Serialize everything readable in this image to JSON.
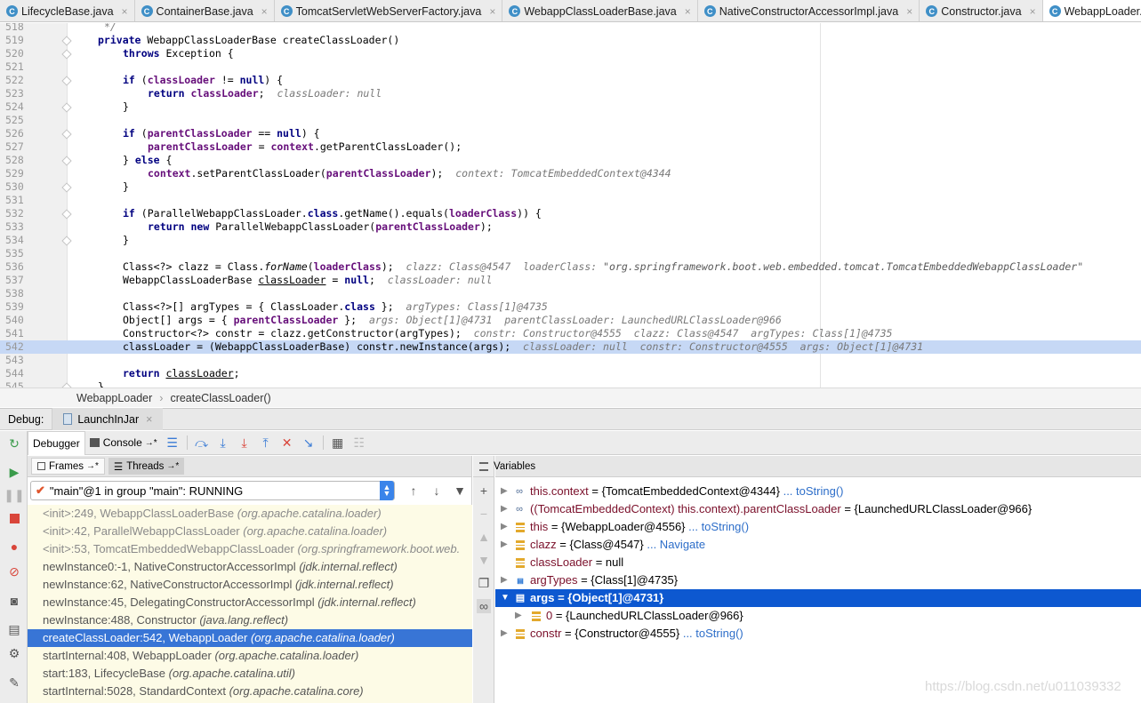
{
  "tabs": [
    {
      "label": "LifecycleBase.java"
    },
    {
      "label": "ContainerBase.java"
    },
    {
      "label": "TomcatServletWebServerFactory.java"
    },
    {
      "label": "WebappClassLoaderBase.java"
    },
    {
      "label": "NativeConstructorAccessorImpl.java"
    },
    {
      "label": "Constructor.java"
    },
    {
      "label": "WebappLoader.java"
    }
  ],
  "tab_icon_letter": "C",
  "tab_close": "×",
  "editor": {
    "line_numbers": [
      "518",
      "519",
      "520",
      "521",
      "522",
      "523",
      "524",
      "525",
      "526",
      "527",
      "528",
      "529",
      "530",
      "531",
      "532",
      "533",
      "534",
      "535",
      "536",
      "537",
      "538",
      "539",
      "540",
      "541",
      "542",
      "543",
      "544",
      "545"
    ],
    "current_line": "542",
    "comment_518": "*/",
    "l519_private": "private",
    "l519_rest": "WebappClassLoaderBase createClassLoader()",
    "l520_throws": "throws",
    "l520_rest": "Exception {",
    "kw_if": "if",
    "kw_null": "null",
    "kw_return": "return",
    "kw_else": "else",
    "kw_class": "class",
    "kw_new": "new",
    "f_classLoader": "classLoader",
    "f_parentClassLoader": "parentClassLoader",
    "f_context": "context",
    "f_loaderClass": "loaderClass",
    "brace_close": "}",
    "l522_mid": " != ",
    "l522_end": ") {",
    "l523_end": ";",
    "hint_523": "classLoader: null",
    "l526_mid": " == ",
    "l527_mid": " = ",
    "l527_call": ".getParentClassLoader();",
    "l528_a": "} ",
    "l528_b": " {",
    "l529_call": ".setParentClassLoader(",
    "l529_end": ");",
    "hint_529": "context: TomcatEmbeddedContext@4344",
    "l532_a": " (ParallelWebappClassLoader.",
    "l532_b": ".getName().equals(",
    "l532_c": ")) {",
    "l533_a": " ParallelWebappClassLoader(",
    "l533_b": ");",
    "l536_a": "Class<?> clazz = Class.",
    "l536_forName": "forName",
    "l536_b": "(",
    "l536_c": ");",
    "hint_536_a": "clazz: Class@4547  loaderClass: ",
    "hint_536_str": "\"org.springframework.boot.web.embedded.tomcat.TomcatEmbeddedWebappClassLoader\"",
    "l537_a": "WebappClassLoaderBase ",
    "l537_var": "classLoader",
    "l537_b": " = ",
    "l537_c": ";",
    "hint_537": "classLoader: null",
    "l539_a": "Class<?>[] argTypes = { ClassLoader.",
    "l539_b": " };",
    "hint_539": "argTypes: Class[1]@4735",
    "l540_a": "Object[] args = { ",
    "l540_b": " };",
    "hint_540": "args: Object[1]@4731  parentClassLoader: LaunchedURLClassLoader@966",
    "l541_code": "Constructor<?> constr = clazz.getConstructor(argTypes);",
    "hint_541": "constr: Constructor@4555  clazz: Class@4547  argTypes: Class[1]@4735",
    "l542_code": "classLoader = (WebappClassLoaderBase) constr.newInstance(args);",
    "hint_542": "classLoader: null  constr: Constructor@4555  args: Object[1]@4731",
    "l544_a": " ",
    "l544_b": ";"
  },
  "breadcrumb": {
    "items": [
      "WebappLoader",
      "createClassLoader()"
    ],
    "sep": "›"
  },
  "debug": {
    "title": "Debug:",
    "run_config": "LaunchInJar",
    "tab_debugger": "Debugger",
    "tab_console": "Console",
    "tab_console_pin": "→*",
    "frames_label": "Frames",
    "frames_pin": "→*",
    "threads_label": "Threads",
    "threads_pin": "→*",
    "thread_selected": "\"main\"@1 in group \"main\": RUNNING",
    "frames": [
      {
        "method": "<init>:249, WebappClassLoaderBase",
        "pkg": "(org.apache.catalina.loader)",
        "lib": true
      },
      {
        "method": "<init>:42, ParallelWebappClassLoader",
        "pkg": "(org.apache.catalina.loader)",
        "lib": true
      },
      {
        "method": "<init>:53, TomcatEmbeddedWebappClassLoader",
        "pkg": "(org.springframework.boot.web.",
        "lib": true
      },
      {
        "method": "newInstance0:-1, NativeConstructorAccessorImpl",
        "pkg": "(jdk.internal.reflect)",
        "lib": false
      },
      {
        "method": "newInstance:62, NativeConstructorAccessorImpl",
        "pkg": "(jdk.internal.reflect)",
        "lib": false
      },
      {
        "method": "newInstance:45, DelegatingConstructorAccessorImpl",
        "pkg": "(jdk.internal.reflect)",
        "lib": false
      },
      {
        "method": "newInstance:488, Constructor",
        "pkg": "(java.lang.reflect)",
        "lib": false
      },
      {
        "method": "createClassLoader:542, WebappLoader",
        "pkg": "(org.apache.catalina.loader)",
        "lib": false,
        "selected": true
      },
      {
        "method": "startInternal:408, WebappLoader",
        "pkg": "(org.apache.catalina.loader)",
        "lib": false
      },
      {
        "method": "start:183, LifecycleBase",
        "pkg": "(org.apache.catalina.util)",
        "lib": false
      },
      {
        "method": "startInternal:5028, StandardContext",
        "pkg": "(org.apache.catalina.core)",
        "lib": false
      }
    ],
    "variables_label": "Variables",
    "variables": [
      {
        "name": "this.context",
        "value": " = {TomcatEmbeddedContext@4344}",
        "link": " ... toString()",
        "icon": "watch",
        "indent": 0,
        "arrow": "▶"
      },
      {
        "name": "((TomcatEmbeddedContext) this.context).parentClassLoader",
        "value": " = {LaunchedURLClassLoader@966}",
        "link": "",
        "icon": "watch",
        "indent": 0,
        "arrow": "▶"
      },
      {
        "name": "this",
        "value": " = {WebappLoader@4556}",
        "link": " ... toString()",
        "icon": "field",
        "indent": 0,
        "arrow": "▶"
      },
      {
        "name": "clazz",
        "value": " = {Class@4547}",
        "link": " ... Navigate",
        "icon": "field",
        "indent": 0,
        "arrow": "▶"
      },
      {
        "name": "classLoader",
        "value": " = null",
        "link": "",
        "icon": "field",
        "indent": 0,
        "arrow": ""
      },
      {
        "name": "argTypes",
        "value": " = {Class[1]@4735}",
        "link": "",
        "icon": "array",
        "indent": 0,
        "arrow": "▶"
      },
      {
        "name": "args",
        "value": " = {Object[1]@4731}",
        "link": "",
        "icon": "array",
        "indent": 0,
        "arrow": "▼",
        "selected": true
      },
      {
        "name": "0",
        "value": " = {LaunchedURLClassLoader@966}",
        "link": "",
        "icon": "field",
        "indent": 1,
        "arrow": "▶"
      },
      {
        "name": "constr",
        "value": " = {Constructor@4555}",
        "link": " ... toString()",
        "icon": "field",
        "indent": 0,
        "arrow": "▶"
      }
    ]
  },
  "watermark": "https://blog.csdn.net/u011039332"
}
